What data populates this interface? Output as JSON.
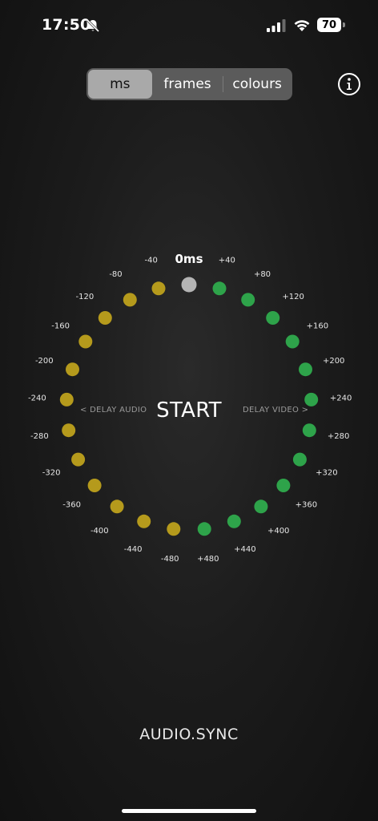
{
  "status_bar": {
    "time": "17:50",
    "battery": "70"
  },
  "tabs": [
    {
      "label": "ms",
      "selected": true
    },
    {
      "label": "frames",
      "selected": false
    },
    {
      "label": "colours",
      "selected": false
    }
  ],
  "dial": {
    "center_label": "0ms",
    "start_label": "START",
    "delay_audio_label": "< DELAY AUDIO",
    "delay_video_label": "DELAY VIDEO >",
    "colors": {
      "zero": "#b4b4b4",
      "audio": "#b59a1c",
      "video": "#2ea34a"
    },
    "markers": [
      {
        "label": "+40",
        "value": 40
      },
      {
        "label": "+80",
        "value": 80
      },
      {
        "label": "+120",
        "value": 120
      },
      {
        "label": "+160",
        "value": 160
      },
      {
        "label": "+200",
        "value": 200
      },
      {
        "label": "+240",
        "value": 240
      },
      {
        "label": "+280",
        "value": 280
      },
      {
        "label": "+320",
        "value": 320
      },
      {
        "label": "+360",
        "value": 360
      },
      {
        "label": "+400",
        "value": 400
      },
      {
        "label": "+440",
        "value": 440
      },
      {
        "label": "+480",
        "value": 480
      },
      {
        "label": "-40",
        "value": -40
      },
      {
        "label": "-80",
        "value": -80
      },
      {
        "label": "-120",
        "value": -120
      },
      {
        "label": "-160",
        "value": -160
      },
      {
        "label": "-200",
        "value": -200
      },
      {
        "label": "-240",
        "value": -240
      },
      {
        "label": "-280",
        "value": -280
      },
      {
        "label": "-320",
        "value": -320
      },
      {
        "label": "-360",
        "value": -360
      },
      {
        "label": "-400",
        "value": -400
      },
      {
        "label": "-440",
        "value": -440
      },
      {
        "label": "-480",
        "value": -480
      }
    ]
  },
  "app_name": "AUDIO.SYNC"
}
